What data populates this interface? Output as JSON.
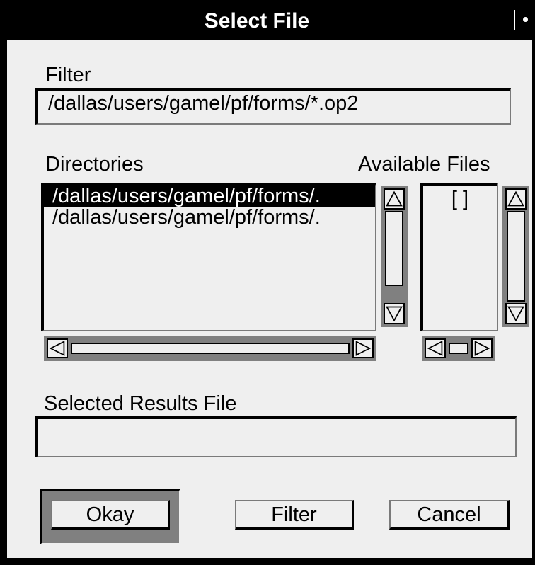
{
  "dialog": {
    "title": "Select File",
    "filter_label": "Filter",
    "filter_value": "/dallas/users/gamel/pf/forms/*.op2",
    "directories_label": "Directories",
    "available_files_label": "Available Files",
    "directories": [
      "/dallas/users/gamel/pf/forms/.",
      "/dallas/users/gamel/pf/forms/."
    ],
    "selected_directory_index": 0,
    "files": [
      "[ ]"
    ],
    "selected_results_label": "Selected Results File",
    "selected_results_value": "",
    "buttons": {
      "okay": "Okay",
      "filter": "Filter",
      "cancel": "Cancel"
    }
  },
  "icons": {
    "window_menu": "window-menu-icon",
    "scroll_up": "up-triangle-icon",
    "scroll_down": "down-triangle-icon",
    "scroll_left": "left-triangle-icon",
    "scroll_right": "right-triangle-icon"
  },
  "colors": {
    "window_background": "#efefef",
    "frame": "#000000",
    "scroll_track": "#808080",
    "selection_background": "#000000",
    "selection_text": "#ffffff"
  }
}
